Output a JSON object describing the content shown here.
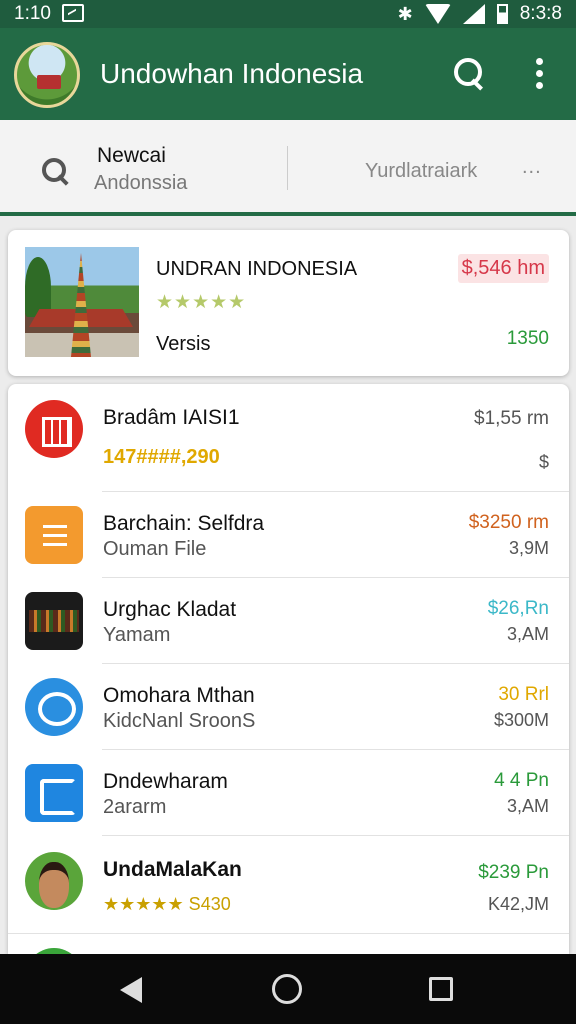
{
  "status_bar": {
    "time": "1:10",
    "right_time": "8:3:8",
    "bluetooth": "$"
  },
  "app_bar": {
    "title": "Undowhan Indonesia",
    "logo_icon": "app-logo-icon",
    "search_icon": "search-icon",
    "more_icon": "more-vert-icon"
  },
  "search": {
    "line1": "Newcai",
    "line2": "Andonssia",
    "right_label": "Yurdlatraiark",
    "right_more": "..."
  },
  "featured": {
    "title": "UNDRAN INDONESIA",
    "stars": "★★★★★",
    "subtitle": "Versis",
    "price": "$,546 hm",
    "price2": "1350",
    "price_color": "#d6384a",
    "price2_color": "#2a9a3a"
  },
  "list": [
    {
      "title": "Bradâm IAISI1",
      "subtitle": "147####,290",
      "price": "$1,55 rm",
      "size": "$",
      "icon": "box-icon",
      "price_color": "#555555",
      "subtitle_color": "#e0a800"
    },
    {
      "title": "Barchain: Selfdra",
      "subtitle": "Ouman File",
      "price": "$3250 rm",
      "size": "3,9M",
      "icon": "document-list-icon",
      "price_color": "#d0621e",
      "subtitle_color": "#555555"
    },
    {
      "title": "Urghac Kladat",
      "subtitle": "Yamam",
      "price": "$26,Rn",
      "size": "3,AM",
      "icon": "game-icon",
      "price_color": "#3bb8c8",
      "subtitle_color": "#555555"
    },
    {
      "title": "Omohara Mthan",
      "subtitle": "KidcNanl SroonS",
      "price": "30 Rrl",
      "size": "$300M",
      "icon": "chat-bubble-icon",
      "price_color": "#e0a800",
      "subtitle_color": "#555555"
    },
    {
      "title": "Dndewharam",
      "subtitle": "2ararm",
      "price": "4 4 Pn",
      "size": "3,AM",
      "icon": "square-app-icon",
      "price_color": "#2a9a3a",
      "subtitle_color": "#555555"
    },
    {
      "title": "UndaMalaKan",
      "subtitle": "★★★★★ S430",
      "price": "$239 Pn",
      "size": "K42,JM",
      "icon": "user-avatar-icon",
      "price_color": "#2a9a3a",
      "subtitle_color": "#c9a000"
    },
    {
      "title": "",
      "subtitle": "",
      "price": "",
      "size": "",
      "icon": "app-icon",
      "price_color": "#2a9a3a",
      "subtitle_color": "#555555"
    }
  ],
  "navbar": {
    "back_icon": "back-icon",
    "home_icon": "home-icon",
    "recent_icon": "recent-apps-icon"
  },
  "colors": {
    "app_bar": "#236b46",
    "status_bar": "#1f5c3e",
    "accent_green": "#2a9a3a"
  }
}
